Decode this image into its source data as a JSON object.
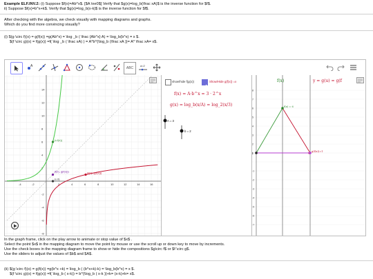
{
  "header": {
    "title": "Example ELF.INV.2:",
    "line1": "(i) Suppose $f(x)=Ab^x$. [$A \\ne0$]  Verify that $g(x)=log_b(\\frac xA)$ is the inverse function for $f$.",
    "line2": "ii) Suppose $f(x)=b^x+k$. Verify that $g(x)=log_b(x-k)$  is the inverse function for $f$."
  },
  "intro": {
    "line1": "After checking with the algebra, we check visually with mapping diagrams and graphs.",
    "line2": "Which do you find more convincing visually?"
  },
  "part_i": {
    "line1": "(i) $(g \\circ f)(x) = g(f(x)) =g(Ab^x) = \\log _b ( \\frac {Ab^x} A)   = \\log_b(b^x) = x $.",
    "line2": "$(f \\circ g)(x) = f(g(x)) =f( \\log _b ( \\frac xA) ) = A*b^{\\log_b (\\frac xA )}= A* \\frac xA= x$."
  },
  "toolbar": {
    "tools": [
      "move-tool",
      "point-tool",
      "line-tool",
      "perpendicular-tool",
      "polygon-tool",
      "circle-tool",
      "conic-tool",
      "angle-tool",
      "reflect-tool",
      "text-tool",
      "slider-tool",
      "move-view-tool"
    ],
    "text_tool_label": "ABC",
    "slider_tool_label": "a=2"
  },
  "graph1": {
    "x_ticks": [
      "-4",
      "-2",
      "2",
      "4",
      "6",
      "8",
      "10",
      "12",
      "14",
      "16"
    ],
    "y_ticks": [
      "14",
      "12",
      "10",
      "8",
      "6",
      "4",
      "2",
      "-2",
      "-4",
      "-6",
      "-8"
    ],
    "point_fx_label": "(x,f(x))",
    "point_gfx_label": "(f(x), g(f(x)))",
    "point_x0_label": "(x,0)",
    "point_fg_label": "(f(x), g(f(x)))",
    "curve_colors": {
      "f": "#44c844",
      "g": "#c4122f"
    }
  },
  "panel2": {
    "checkbox1_label": "show/hide f(g(x))",
    "checkbox2_label": "Show/Hide g(f(x)) =x",
    "checkbox1_checked": false,
    "checkbox2_checked": true,
    "f_formula": "f(x) = A·b^x = 3 · 2^x",
    "g_formula": "g(x) = log_b(x/A) = log_2(x/3)",
    "slider_A_label": "A = 3",
    "slider_b_label": "b = 2"
  },
  "graph3": {
    "title_left": "f(x)",
    "title_right": "y = g(u) = g(f",
    "x_label": "x = 1",
    "u_label": "f(x) = 6",
    "y_label": "g(f(x))=1",
    "y_ticks": [
      "8",
      "7",
      "6",
      "5",
      "4",
      "3",
      "2",
      "1",
      "-1",
      "-2",
      "-3",
      "-4",
      "-5",
      "-6",
      "-7"
    ]
  },
  "instructions": {
    "line1": "In the graph frame, click on the play arrow to animate or stop value of $x$ .",
    "line2": "Select the point $x$ in the mapping diagram to move the point by mouse or use the scroll up or down key to move by increments.",
    "line3": "Use the check boxes in the mapping diagram frame to show or hide the compositions $g\\circ f$ or $f \\circ g$.",
    "line4": "Use the sliders to adjust the values of $b$ and $A$."
  },
  "part_ii": {
    "line1": "(ii) $(g \\circ f)(x) = g(f(x)) =g(b^x +k) = \\log_b ( (b^x+k)-k)  = \\log_b(b^x) = x $.",
    "line2": "$(f \\circ g)(x) = f(g(x)) =f( \\log_b ( x-k)) = b^{\\log_b ( x-k )}+k=  (x-k)+k= x$."
  }
}
